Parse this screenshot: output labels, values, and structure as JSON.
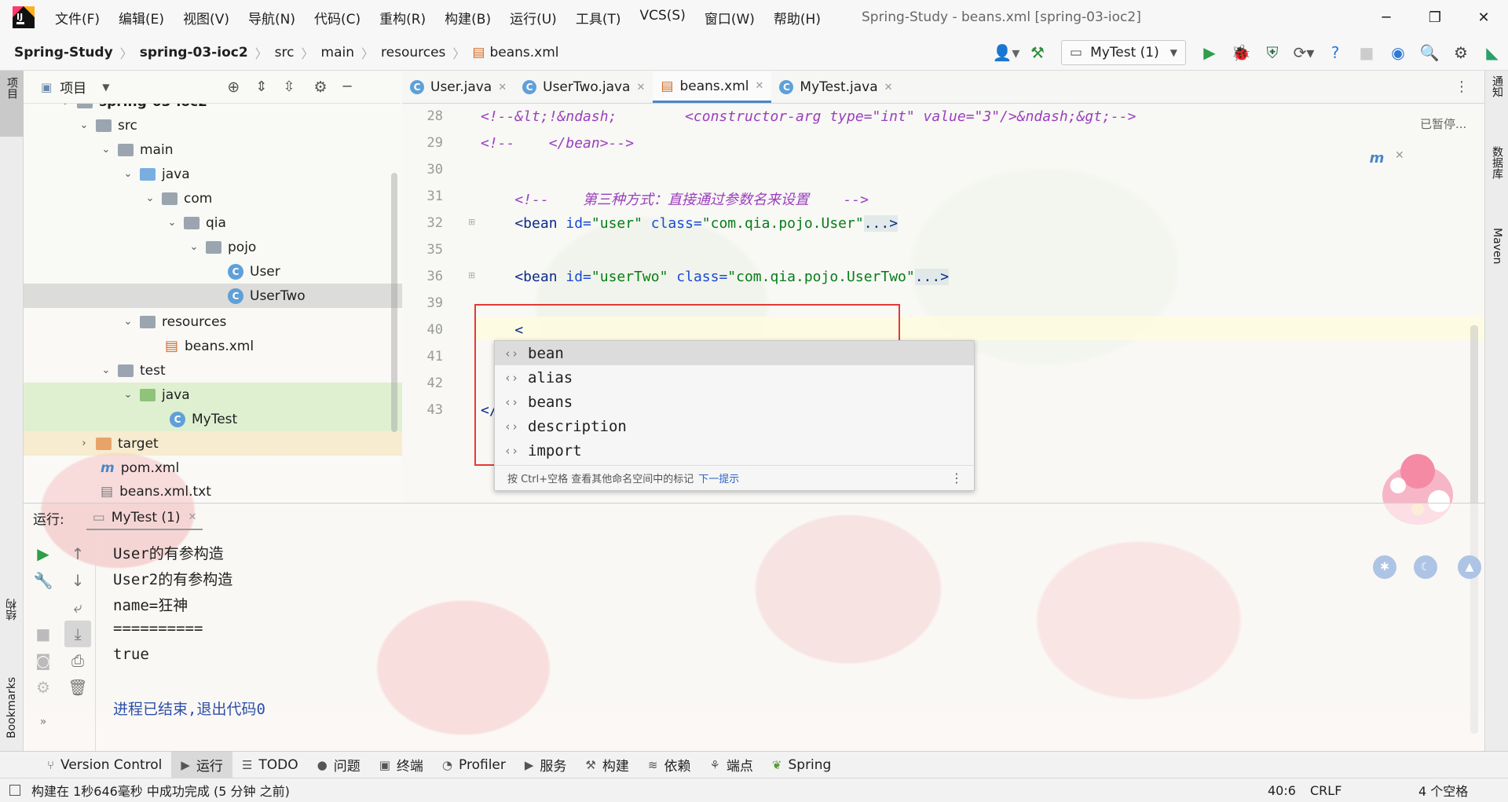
{
  "app": {
    "title": "Spring-Study - beans.xml [spring-03-ioc2]"
  },
  "menu": [
    "文件(F)",
    "编辑(E)",
    "视图(V)",
    "导航(N)",
    "代码(C)",
    "重构(R)",
    "构建(B)",
    "运行(U)",
    "工具(T)",
    "VCS(S)",
    "窗口(W)",
    "帮助(H)"
  ],
  "breadcrumb": [
    "Spring-Study",
    "spring-03-ioc2",
    "src",
    "main",
    "resources",
    "beans.xml"
  ],
  "toolbar": {
    "run_config": "MyTest (1)"
  },
  "side": {
    "project": "项目",
    "notifications": "通知",
    "database": "数据库",
    "maven": "Maven",
    "structure": "结构",
    "bookmarks": "Bookmarks"
  },
  "project": {
    "title": "项目",
    "tree": [
      {
        "label": "spring-03-ioc2",
        "depth": 2
      },
      {
        "label": "src",
        "depth": 3
      },
      {
        "label": "main",
        "depth": 4
      },
      {
        "label": "java",
        "depth": 5
      },
      {
        "label": "com",
        "depth": 6
      },
      {
        "label": "qia",
        "depth": 7
      },
      {
        "label": "pojo",
        "depth": 8
      },
      {
        "label": "User",
        "depth": 9
      },
      {
        "label": "UserTwo",
        "depth": 9
      },
      {
        "label": "resources",
        "depth": 5
      },
      {
        "label": "beans.xml",
        "depth": 6
      },
      {
        "label": "test",
        "depth": 4
      },
      {
        "label": "java",
        "depth": 5
      },
      {
        "label": "MyTest",
        "depth": 6
      },
      {
        "label": "target",
        "depth": 3
      },
      {
        "label": "pom.xml",
        "depth": 3
      },
      {
        "label": "beans.xml.txt",
        "depth": 3
      }
    ]
  },
  "tabs": [
    "User.java",
    "UserTwo.java",
    "beans.xml",
    "MyTest.java"
  ],
  "editor": {
    "status": "已暂停...",
    "lines": [
      {
        "n": "28",
        "text": "<!--&lt;!&ndash;        <constructor-arg type=\"int\" value=\"3\"/>&ndash;&gt;-->"
      },
      {
        "n": "29",
        "text": "<!--    </bean>-->"
      },
      {
        "n": "30",
        "text": ""
      },
      {
        "n": "31",
        "text": "    <!--    第三种方式：直接通过参数名来设置    -->"
      },
      {
        "n": "32",
        "tag": "    <bean ",
        "a1": "id=",
        "v1": "\"user\"",
        "a2": " class=",
        "v2": "\"com.qia.pojo.User\"",
        "end": "...>"
      },
      {
        "n": "35",
        "text": ""
      },
      {
        "n": "36",
        "tag": "    <bean ",
        "a1": "id=",
        "v1": "\"userTwo\"",
        "a2": " class=",
        "v2": "\"com.qia.pojo.UserTwo\"",
        "end": "...>"
      },
      {
        "n": "39",
        "text": ""
      },
      {
        "n": "40",
        "text": "    <"
      },
      {
        "n": "41",
        "text": ""
      },
      {
        "n": "42",
        "text": ""
      },
      {
        "n": "43",
        "text": "</"
      }
    ],
    "completion": {
      "items": [
        "bean",
        "alias",
        "beans",
        "description",
        "import"
      ],
      "footer": "按 Ctrl+空格 查看其他命名空间中的标记",
      "footer_link": "下一提示"
    }
  },
  "run": {
    "label": "运行:",
    "tab": "MyTest (1)",
    "output": [
      "User的有参构造",
      "User2的有参构造",
      "name=狂神",
      "==========",
      "true",
      "",
      "进程已结束,退出代码0"
    ]
  },
  "bottom_tabs": [
    "Version Control",
    "运行",
    "TODO",
    "问题",
    "终端",
    "Profiler",
    "服务",
    "构建",
    "依赖",
    "端点",
    "Spring"
  ],
  "statusbar": {
    "message": "构建在 1秒646毫秒 中成功完成 (5 分钟 之前)",
    "position": "40:6",
    "line_ending": "CRLF",
    "indent": "4 个空格"
  },
  "colors": {
    "accent": "#4a86c8",
    "highlight_box": "#e53935",
    "comment": "#9a3fbd",
    "string": "#067d17"
  }
}
